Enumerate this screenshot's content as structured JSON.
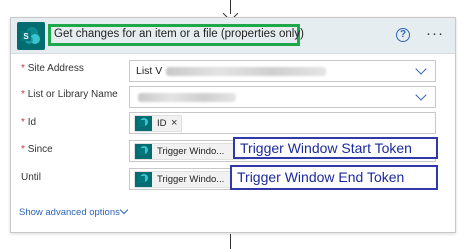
{
  "action": {
    "title": "Get changes for an item or a file (properties only)",
    "help_icon": "?",
    "more_icon": "···",
    "connector_icon": "sharepoint-icon"
  },
  "fields": {
    "site_address": {
      "label": "Site Address",
      "required": true,
      "value": "List V"
    },
    "list_or_library": {
      "label": "List or Library Name",
      "required": true,
      "value": ""
    },
    "id": {
      "label": "Id",
      "required": true,
      "token": "ID"
    },
    "since": {
      "label": "Since",
      "required": true,
      "token": "Trigger Windo..."
    },
    "until": {
      "label": "Until",
      "required": false,
      "token": "Trigger Windo..."
    }
  },
  "required_marker": "*",
  "token_remove": "×",
  "annotations": {
    "start": "Trigger Window Start Token",
    "end": "Trigger Window End Token"
  },
  "advanced_label": "Show advanced options",
  "colors": {
    "header_bg": "#e6edf1",
    "title_highlight": "#1ea84a",
    "annotation": "#3139a8",
    "link": "#2e65b4",
    "sharepoint": "#036c70"
  }
}
